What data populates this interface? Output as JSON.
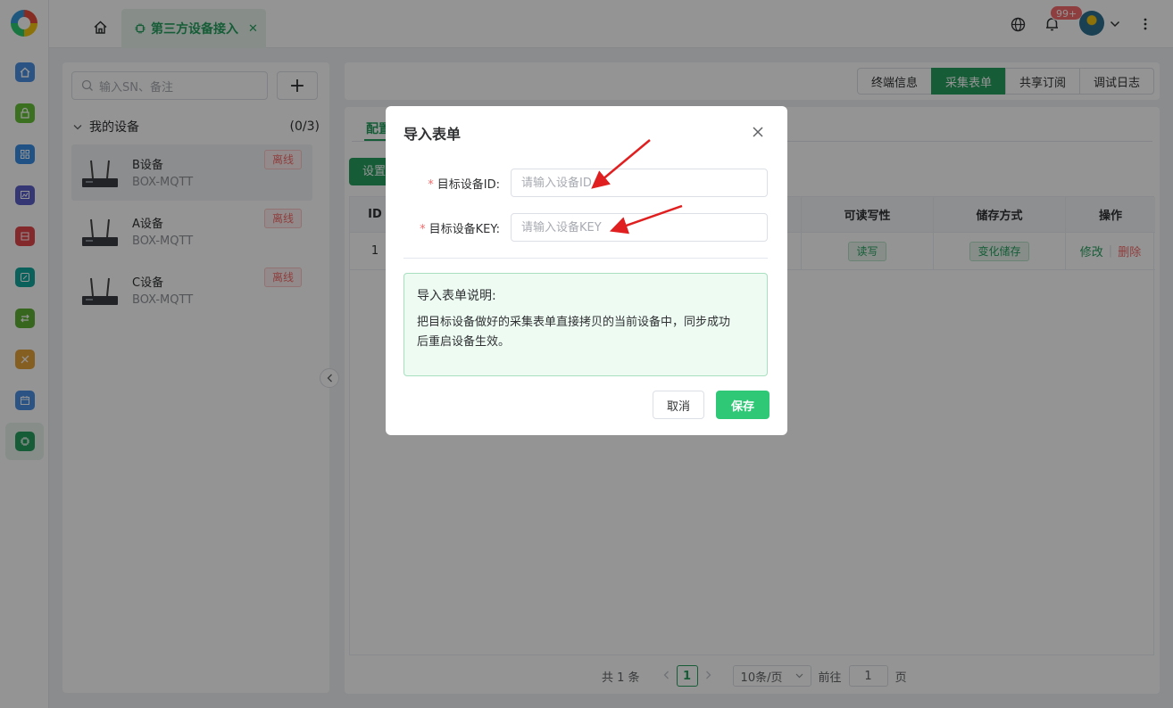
{
  "colors": {
    "accent": "#27a060",
    "danger": "#f56c6c",
    "save_button": "#2fc877"
  },
  "topbar": {
    "tab_label": "第三方设备接入",
    "notification_count": "99+",
    "icons": [
      "home-icon",
      "chip-icon",
      "close-icon",
      "globe-icon",
      "bell-icon",
      "avatar",
      "chevron-down-icon",
      "more-vertical-icon"
    ]
  },
  "sidebar_icons": [
    "home-icon",
    "lock-icon",
    "grid-icon",
    "chart-icon",
    "box-icon",
    "frame-icon",
    "transfer-icon",
    "tool-icon",
    "calendar-icon",
    "chip-icon"
  ],
  "device_panel": {
    "search_placeholder": "输入SN、备注",
    "add_label": "+",
    "group_label": "我的设备",
    "group_count": "(0/3)",
    "devices": [
      {
        "name": "B设备",
        "model": "BOX-MQTT",
        "status": "离线"
      },
      {
        "name": "A设备",
        "model": "BOX-MQTT",
        "status": "离线"
      },
      {
        "name": "C设备",
        "model": "BOX-MQTT",
        "status": "离线"
      }
    ]
  },
  "top_tabs": [
    "终端信息",
    "采集表单",
    "共享订阅",
    "调试日志"
  ],
  "content": {
    "sub_tab": "配置",
    "set_button": "设置",
    "table": {
      "headers": [
        "ID",
        "可读写性",
        "储存方式",
        "操作"
      ],
      "rows": [
        {
          "id": "1",
          "rw": "读写",
          "storage": "变化储存",
          "edit": "修改",
          "delete": "删除"
        }
      ]
    }
  },
  "pagination": {
    "total": "共 1 条",
    "current_page": "1",
    "page_size": "10条/页",
    "goto_label": "前往",
    "goto_value": "1",
    "page_suffix": "页"
  },
  "dialog": {
    "title": "导入表单",
    "field_id_label": "目标设备ID:",
    "field_id_placeholder": "请输入设备ID",
    "field_key_label": "目标设备KEY:",
    "field_key_placeholder": "请输入设备KEY",
    "required_mark": "*",
    "note_title": "导入表单说明:",
    "note_text_line1": "把目标设备做好的采集表单直接拷贝的当前设备中，同步成功",
    "note_text_line2": "后重启设备生效。",
    "cancel_label": "取消",
    "save_label": "保存"
  }
}
